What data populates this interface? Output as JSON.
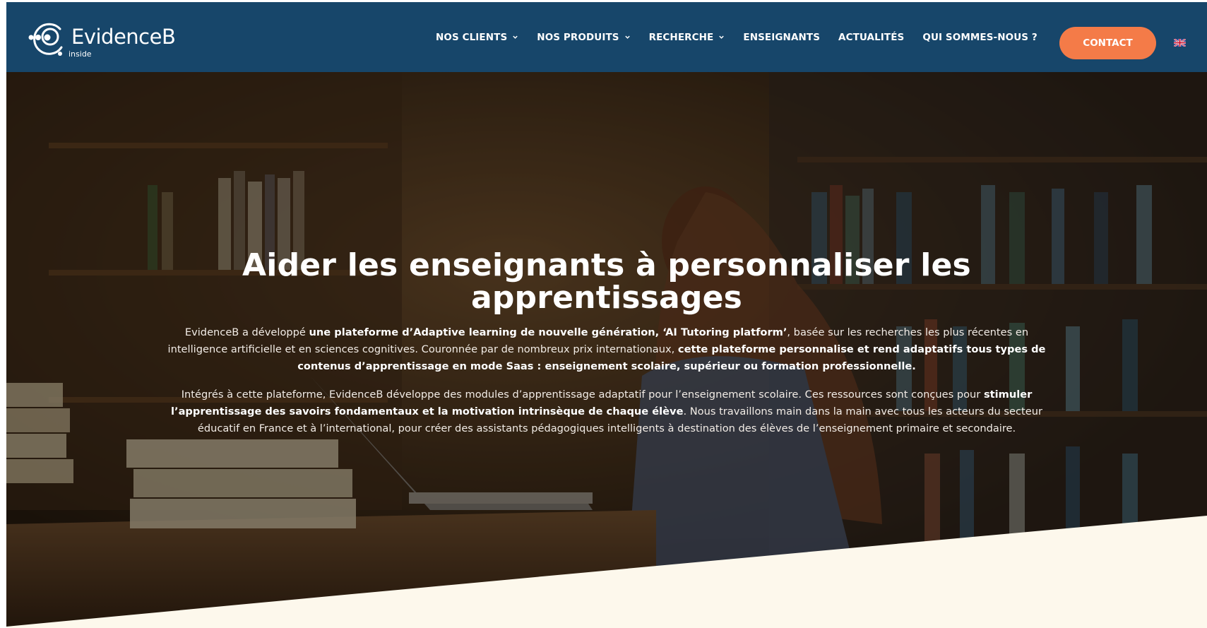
{
  "brand": {
    "name": "EvidenceB",
    "tagline": "inside"
  },
  "nav": {
    "items": [
      {
        "label": "NOS CLIENTS",
        "dropdown": true
      },
      {
        "label": "NOS PRODUITS",
        "dropdown": true
      },
      {
        "label": "RECHERCHE",
        "dropdown": true
      },
      {
        "label": "ENSEIGNANTS",
        "dropdown": false
      },
      {
        "label": "ACTUALITÉS",
        "dropdown": false
      },
      {
        "label": "QUI SOMMES-NOUS ?",
        "dropdown": false
      }
    ],
    "contact_label": "CONTACT",
    "language_icon": "uk-flag-icon"
  },
  "hero": {
    "title": "Aider les enseignants à personnaliser les apprentissages",
    "paragraph1": {
      "t1": "EvidenceB a développé ",
      "b1": "une plateforme d’Adaptive learning de nouvelle génération, ‘AI Tutoring platform’",
      "t2": ", basée sur les recherches les plus récentes en intelligence artificielle et en sciences cognitives. Couronnée par de nombreux prix internationaux, ",
      "b2": "cette plateforme personnalise et rend adaptatifs tous types de contenus d’apprentissage en mode Saas : enseignement scolaire, supérieur ou formation professionnelle."
    },
    "paragraph2": {
      "t1": "Intégrés à cette plateforme, EvidenceB développe des modules d’apprentissage adaptatif pour l’enseignement scolaire. Ces ressources sont conçues pour ",
      "b1": "stimuler l’apprentissage des savoirs fondamentaux et la motivation intrinsèque de chaque élève",
      "t2": ". Nous travaillons main dans la main avec tous les acteurs du secteur éducatif en France et à l’international, pour créer des assistants pédagogiques intelligents à destination des élèves de l’enseignement primaire et secondaire."
    }
  },
  "colors": {
    "header_bg": "#17466a",
    "accent": "#f47b48",
    "section_bg": "#fdf8ec"
  }
}
